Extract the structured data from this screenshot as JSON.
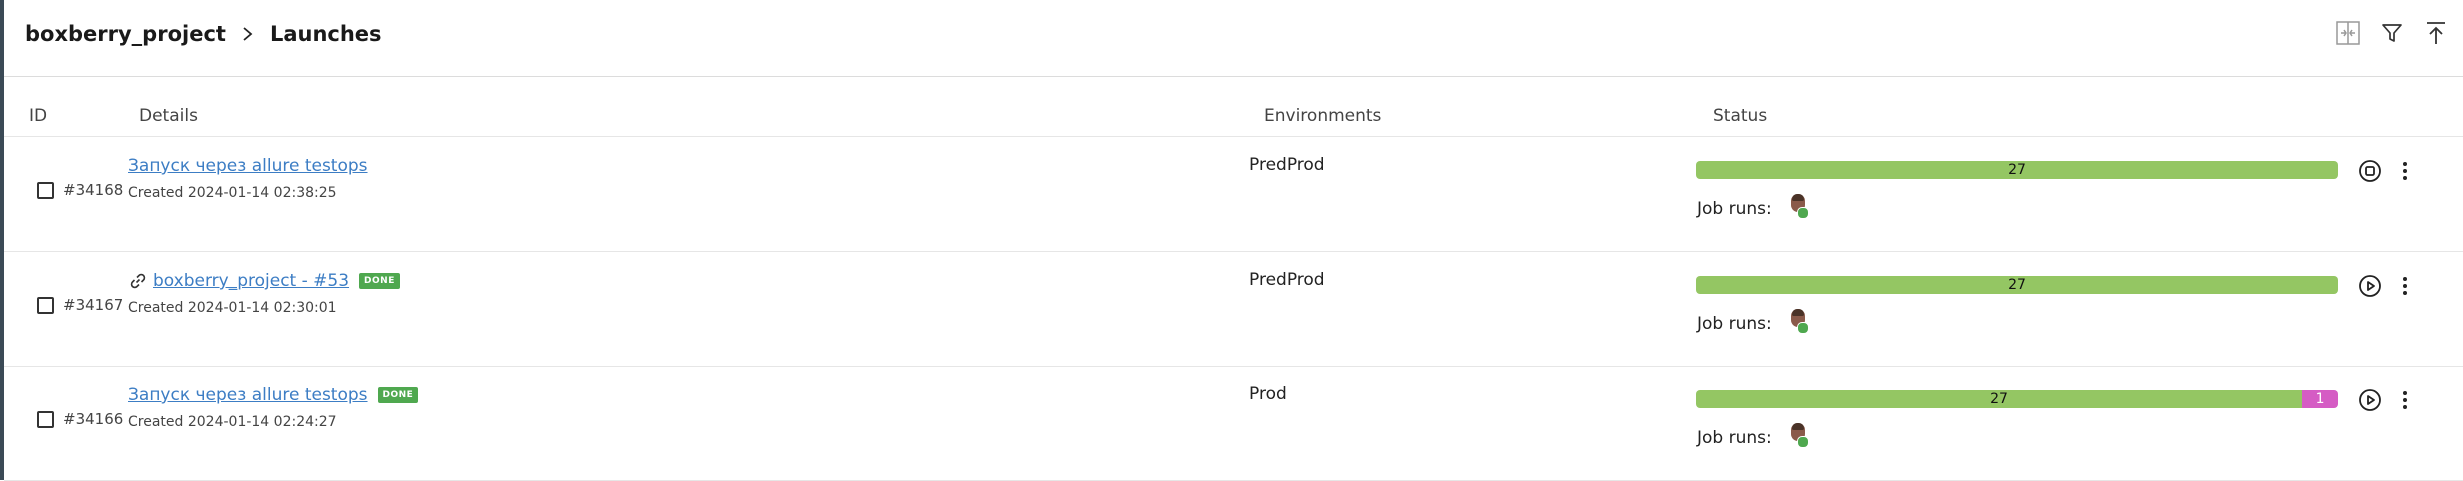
{
  "header": {
    "project": "boxberry_project",
    "current": "Launches",
    "actions": [
      "compare-icon",
      "filter-icon",
      "collapse-up-icon"
    ]
  },
  "columns": {
    "id": "ID",
    "details": "Details",
    "environments": "Environments",
    "status": "Status"
  },
  "rows": [
    {
      "id": "#34168",
      "name": "Запуск через allure testops",
      "has_link_icon": false,
      "badge": "",
      "created": "Created 2024-01-14 02:38:25",
      "environment": "PredProd",
      "passed": "27",
      "failed": "",
      "job_runs_label": "Job runs:",
      "action_icon": "stop-icon"
    },
    {
      "id": "#34167",
      "name": "boxberry_project - #53",
      "has_link_icon": true,
      "badge": "DONE",
      "created": "Created 2024-01-14 02:30:01",
      "environment": "PredProd",
      "passed": "27",
      "failed": "",
      "job_runs_label": "Job runs:",
      "action_icon": "play-icon"
    },
    {
      "id": "#34166",
      "name": "Запуск через allure testops",
      "has_link_icon": false,
      "badge": "DONE",
      "created": "Created 2024-01-14 02:24:27",
      "environment": "Prod",
      "passed": "27",
      "failed": "1",
      "job_runs_label": "Job runs:",
      "action_icon": "play-icon"
    }
  ],
  "colors": {
    "passed": "#94c663",
    "failed": "#d55cc4",
    "link": "#3c7dc4",
    "done_badge": "#4fa84f"
  }
}
